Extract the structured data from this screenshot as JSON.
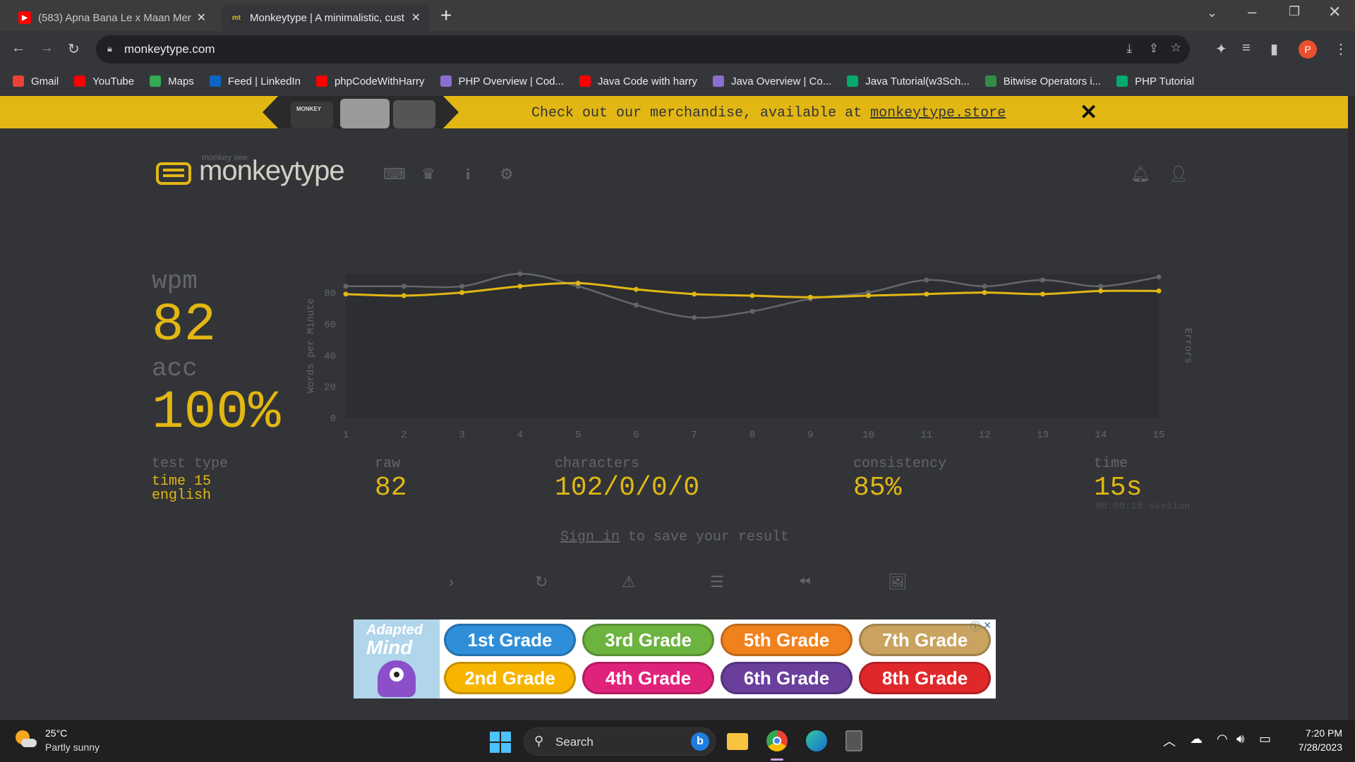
{
  "browser": {
    "tabs": [
      {
        "title": "(583) Apna Bana Le x Maan Meri",
        "favicon": "youtube-icon",
        "active": false
      },
      {
        "title": "Monkeytype | A minimalistic, cust",
        "favicon": "monkeytype-icon",
        "active": true
      }
    ],
    "new_tab": "+",
    "url": "monkeytype.com",
    "bookmarks": [
      {
        "label": "Gmail",
        "icon": "gmail-icon",
        "color": "#ea4335"
      },
      {
        "label": "YouTube",
        "icon": "youtube-icon",
        "color": "#ff0000"
      },
      {
        "label": "Maps",
        "icon": "maps-icon",
        "color": "#34a853"
      },
      {
        "label": "Feed | LinkedIn",
        "icon": "linkedin-icon",
        "color": "#0a66c2"
      },
      {
        "label": "phpCodeWithHarry",
        "icon": "youtube-icon",
        "color": "#ff0000"
      },
      {
        "label": "PHP Overview | Cod...",
        "icon": "avatar-icon",
        "color": "#8a6fd1"
      },
      {
        "label": "Java Code with harry",
        "icon": "youtube-icon",
        "color": "#ff0000"
      },
      {
        "label": "Java Overview | Co...",
        "icon": "avatar-icon",
        "color": "#8a6fd1"
      },
      {
        "label": "Java Tutorial(w3Sch...",
        "icon": "w3schools-icon",
        "color": "#04aa6d"
      },
      {
        "label": "Bitwise Operators i...",
        "icon": "gfg-icon",
        "color": "#2f8d46"
      },
      {
        "label": "PHP Tutorial",
        "icon": "w3schools-icon",
        "color": "#04aa6d"
      }
    ],
    "profile_initial": "P"
  },
  "banner": {
    "text": "Check out our merchandise, available at ",
    "link": "monkeytype.store",
    "shirt_text": "MONKEY"
  },
  "header": {
    "logo_small": "monkey see",
    "logo": "monkeytype"
  },
  "result": {
    "wpm_label": "wpm",
    "wpm": "82",
    "acc_label": "acc",
    "acc": "100%",
    "test_type_label": "test type",
    "test_type_1": "time 15",
    "test_type_2": "english",
    "raw_label": "raw",
    "raw": "82",
    "characters_label": "characters",
    "characters": "102/0/0/0",
    "consistency_label": "consistency",
    "consistency": "85%",
    "time_label": "time",
    "time": "15s",
    "session": "00:00:15 session",
    "signin_link": "Sign in",
    "signin_rest": " to save your result"
  },
  "chart_data": {
    "type": "line",
    "x": [
      1,
      2,
      3,
      4,
      5,
      6,
      7,
      8,
      9,
      10,
      11,
      12,
      13,
      14,
      15
    ],
    "series": [
      {
        "values": [
          84,
          84,
          84,
          92,
          84,
          72,
          64,
          68,
          76,
          80,
          88,
          84,
          88,
          84,
          90
        ],
        "color": "#646669"
      },
      {
        "values": [
          79,
          78,
          80,
          84,
          86,
          82,
          79,
          78,
          77,
          78,
          79,
          80,
          79,
          81,
          81
        ],
        "color": "#e2b714"
      }
    ],
    "ylabel": "Words per Minute",
    "y2label": "Errors",
    "yticks": [
      0,
      20,
      40,
      60,
      80
    ],
    "ylim": [
      0,
      92
    ]
  },
  "ad": {
    "brand_1": "Adapted",
    "brand_2": "Mind",
    "grades": [
      {
        "label": "1st Grade",
        "color": "#2e8fd8"
      },
      {
        "label": "3rd Grade",
        "color": "#6cb33f"
      },
      {
        "label": "5th Grade",
        "color": "#f0821e"
      },
      {
        "label": "7th Grade",
        "color": "#c9a35f"
      },
      {
        "label": "2nd Grade",
        "color": "#f7b500"
      },
      {
        "label": "4th Grade",
        "color": "#e0237a"
      },
      {
        "label": "6th Grade",
        "color": "#6a3f9c"
      },
      {
        "label": "8th Grade",
        "color": "#e0282b"
      }
    ]
  },
  "taskbar": {
    "temp": "25°C",
    "weather": "Partly sunny",
    "search": "Search",
    "time": "7:20 PM",
    "date": "7/28/2023"
  }
}
